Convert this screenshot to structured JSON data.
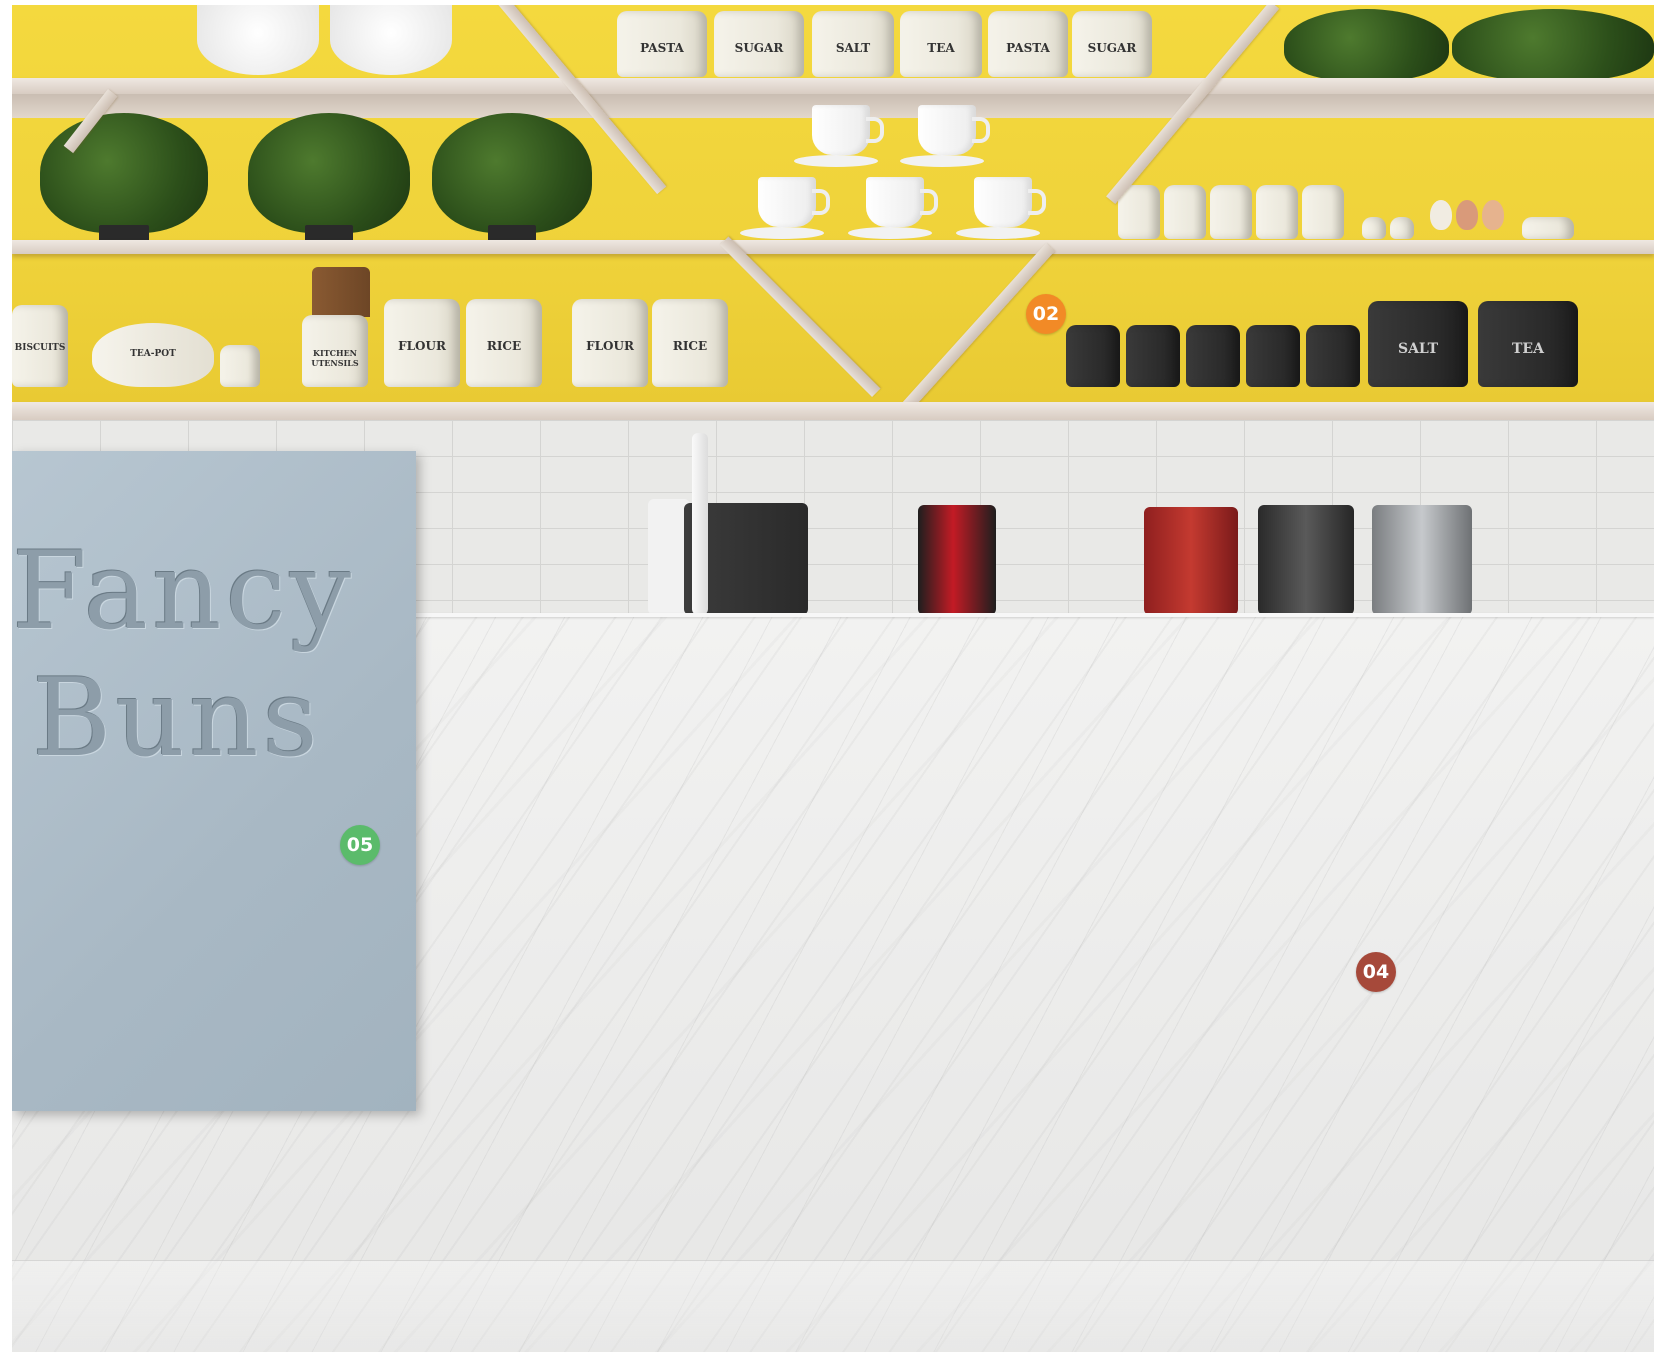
{
  "sign": {
    "line1": "Fancy",
    "line2": "Buns"
  },
  "markers": [
    {
      "label": "02",
      "color": "#f28a26"
    },
    {
      "label": "05",
      "color": "#5bbb6b"
    },
    {
      "label": "04",
      "color": "#a6493a"
    }
  ],
  "jars_top": [
    "PASTA",
    "SUGAR",
    "SALT",
    "TEA",
    "PASTA",
    "SUGAR"
  ],
  "jars_bottom_left": [
    "BISCUITS",
    "TEA-POT",
    "KITCHEN UTENSILS",
    "FLOUR",
    "RICE",
    "FLOUR",
    "RICE"
  ],
  "jars_bottom_right": [
    "SALT",
    "TEA"
  ],
  "colors": {
    "wall": "#f0d43a",
    "sign": "#a9b9c5",
    "counter": "#ececeb"
  }
}
